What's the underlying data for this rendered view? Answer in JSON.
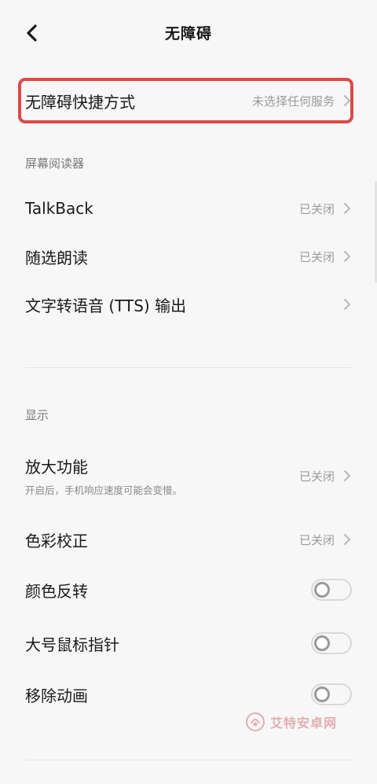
{
  "header": {
    "title": "无障碍"
  },
  "shortcut": {
    "label": "无障碍快捷方式",
    "value": "未选择任何服务"
  },
  "sections": {
    "screen_reader": {
      "title": "屏幕阅读器",
      "items": [
        {
          "label": "TalkBack",
          "value": "已关闭"
        },
        {
          "label": "随选朗读",
          "value": "已关闭"
        },
        {
          "label": "文字转语音 (TTS) 输出",
          "value": ""
        }
      ]
    },
    "display": {
      "title": "显示",
      "magnify": {
        "label": "放大功能",
        "sublabel": "开启后，手机响应速度可能会变慢。",
        "value": "已关闭"
      },
      "color_correction": {
        "label": "色彩校正",
        "value": "已关闭"
      },
      "toggles": [
        {
          "label": "颜色反转",
          "on": false
        },
        {
          "label": "大号鼠标指针",
          "on": false
        },
        {
          "label": "移除动画",
          "on": false
        }
      ]
    }
  },
  "watermark": {
    "text": "艾特安卓网"
  },
  "colors": {
    "highlight": "#e04848",
    "watermark": "#d4737a"
  }
}
